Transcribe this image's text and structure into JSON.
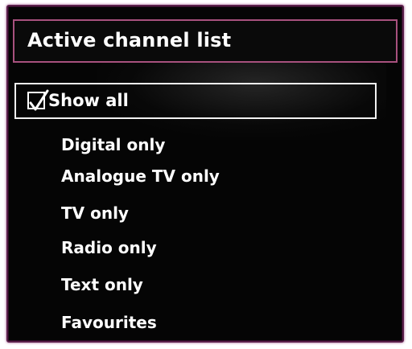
{
  "menu": {
    "title": "Active channel list",
    "selected": {
      "label": "Show all",
      "checked": true
    },
    "options": [
      "Digital only",
      "Analogue TV only",
      "TV only",
      "Radio only",
      "Text only",
      "Favourites"
    ]
  },
  "colors": {
    "panel_background": "#050505",
    "title_border": "#a8517e",
    "selection_border": "#f2f2f2",
    "text": "#ffffff"
  },
  "icons": {
    "selected_item": "checkmark-icon"
  }
}
